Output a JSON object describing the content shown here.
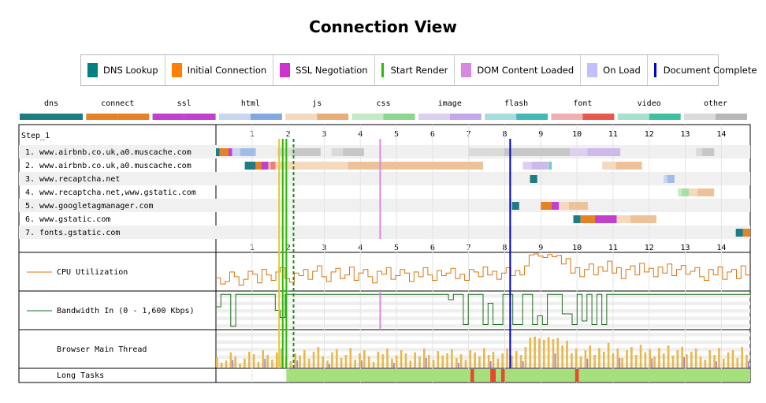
{
  "title": "Connection View",
  "legend": [
    {
      "label": "DNS Lookup",
      "color": "#008080",
      "kind": "box"
    },
    {
      "label": "Initial Connection",
      "color": "#ff7f00",
      "kind": "box"
    },
    {
      "label": "SSL Negotiation",
      "color": "#cc33cc",
      "kind": "box"
    },
    {
      "label": "Start Render",
      "color": "#28bc00",
      "kind": "line"
    },
    {
      "label": "DOM Content Loaded",
      "color": "#d888df",
      "kind": "box"
    },
    {
      "label": "On Load",
      "color": "#c0c0ff",
      "kind": "box"
    },
    {
      "label": "Document Complete",
      "color": "#0000d0",
      "kind": "line"
    }
  ],
  "type_legend": [
    {
      "label": "dns",
      "light": "#1f7c83",
      "dark": "#1f7c83"
    },
    {
      "label": "connect",
      "light": "#e58226",
      "dark": "#e58226"
    },
    {
      "label": "ssl",
      "light": "#c141cd",
      "dark": "#c141cd"
    },
    {
      "label": "html",
      "light": "#c8d6ee",
      "dark": "#82a8e0"
    },
    {
      "label": "js",
      "light": "#f4d9bd",
      "dark": "#e8ae7a"
    },
    {
      "label": "css",
      "light": "#c3eac3",
      "dark": "#8ed68e"
    },
    {
      "label": "image",
      "light": "#dccff0",
      "dark": "#c2a8e8"
    },
    {
      "label": "flash",
      "light": "#a6dcdc",
      "dark": "#45b8b8"
    },
    {
      "label": "font",
      "light": "#f0b0b0",
      "dark": "#e8584f"
    },
    {
      "label": "video",
      "light": "#a8e0d0",
      "dark": "#40c0a0"
    },
    {
      "label": "other",
      "light": "#dadada",
      "dark": "#b8b8b8"
    }
  ],
  "step_label": "Step_1",
  "rows": [
    "1. www.airbnb.co.uk,a0.muscache.com",
    "2. www.airbnb.co.uk,a0.muscache.com",
    "3. www.recaptcha.net",
    "4. www.recaptcha.net,www.gstatic.com",
    "5. www.googletagmanager.com",
    "6. www.gstatic.com",
    "7. fonts.gstatic.com"
  ],
  "ticks": [
    "1",
    "2",
    "3",
    "4",
    "5",
    "6",
    "7",
    "8",
    "9",
    "10",
    "11",
    "12",
    "13",
    "14"
  ],
  "graph_labels": {
    "cpu": "CPU Utilization",
    "bandwidth": "Bandwidth In (0 - 1,600 Kbps)",
    "main_thread": "Browser Main Thread",
    "long_tasks": "Long Tasks"
  },
  "chart_data": {
    "type": "waterfall",
    "x_unit": "seconds",
    "xlim": [
      0,
      14.8
    ],
    "markers": {
      "start_render": [
        1.75,
        1.85,
        1.95
      ],
      "dom_content_loaded": 4.55,
      "document_complete": 8.15,
      "dashed": 2.15
    },
    "connections": [
      [
        [
          "dns",
          0,
          0.1
        ],
        [
          "connect",
          0.1,
          0.35
        ],
        [
          "ssl",
          0.35,
          0.45
        ],
        [
          "html",
          0.45,
          1.1
        ],
        [
          "other",
          1.7,
          2.9
        ],
        [
          "other",
          3.2,
          4.1
        ],
        [
          "other",
          7,
          9.8
        ],
        [
          "image",
          9.8,
          11.2
        ],
        [
          "other",
          13.3,
          13.8
        ]
      ],
      [
        [
          "dns",
          0.8,
          1.1
        ],
        [
          "connect",
          1.1,
          1.25
        ],
        [
          "ssl",
          1.25,
          1.45
        ],
        [
          "font",
          1.45,
          1.65
        ],
        [
          "js",
          1.65,
          7.4
        ],
        [
          "image",
          8.5,
          9.2
        ],
        [
          "flash",
          9.2,
          9.3
        ],
        [
          "js",
          10.7,
          11.8
        ]
      ],
      [
        [
          "dns",
          8.7,
          8.9
        ],
        [
          "html",
          12.4,
          12.7
        ]
      ],
      [
        [
          "css",
          12.8,
          13.1
        ],
        [
          "js",
          13.1,
          13.8
        ]
      ],
      [
        [
          "dns",
          8.2,
          8.4
        ],
        [
          "connect",
          9.0,
          9.3
        ],
        [
          "ssl",
          9.3,
          9.5
        ],
        [
          "js",
          9.5,
          10.3
        ]
      ],
      [
        [
          "dns",
          9.9,
          10.1
        ],
        [
          "connect",
          10.1,
          10.5
        ],
        [
          "ssl",
          10.5,
          11.1
        ],
        [
          "js",
          11.1,
          12.2
        ]
      ],
      [
        [
          "dns",
          14.4,
          14.6
        ],
        [
          "connect",
          14.6,
          14.8
        ]
      ]
    ],
    "cpu": [
      32,
      15,
      22,
      48,
      35,
      12,
      28,
      50,
      42,
      18,
      55,
      40,
      25,
      48,
      60,
      30,
      20,
      45,
      38,
      55,
      28,
      50,
      65,
      35,
      22,
      48,
      58,
      30,
      40,
      62,
      25,
      45,
      55,
      35,
      18,
      50,
      42,
      60,
      28,
      38,
      55,
      45,
      22,
      48,
      35,
      60,
      40,
      25,
      52,
      38,
      45,
      58,
      30,
      42,
      25,
      55,
      48,
      35,
      62,
      40,
      50,
      28,
      45,
      60,
      38,
      52,
      40,
      65,
      95,
      98,
      92,
      88,
      96,
      90,
      94,
      70,
      85,
      45,
      60,
      35,
      55,
      70,
      40,
      62,
      50,
      78,
      45,
      60,
      30,
      55,
      65,
      40,
      72,
      48,
      58,
      35,
      62,
      45,
      70,
      38,
      55,
      66,
      42,
      50,
      60,
      35,
      25,
      55,
      40,
      62,
      28,
      48,
      55,
      30,
      65,
      40
    ],
    "bandwidth": [
      60,
      95,
      95,
      5,
      95,
      95,
      95,
      95,
      95,
      95,
      95,
      95,
      50,
      30,
      95,
      95,
      95,
      95,
      95,
      95,
      95,
      95,
      95,
      95,
      95,
      95,
      95,
      95,
      95,
      95,
      95,
      95,
      95,
      95,
      95,
      95,
      95,
      95,
      95,
      95,
      95,
      95,
      95,
      95,
      95,
      95,
      95,
      80,
      95,
      95,
      10,
      95,
      95,
      95,
      10,
      70,
      10,
      10,
      95,
      95,
      10,
      10,
      95,
      95,
      10,
      35,
      10,
      95,
      95,
      95,
      40,
      40,
      10,
      95,
      20,
      95,
      10,
      95,
      10,
      95,
      95,
      95,
      95,
      95,
      95,
      95,
      95,
      95,
      95,
      95,
      95,
      95,
      95,
      95,
      95,
      95,
      95,
      95,
      95,
      95,
      95,
      95,
      95,
      95,
      95,
      95,
      95,
      95
    ],
    "long_tasks": [
      [
        7.05,
        7.15
      ],
      [
        7.6,
        7.75
      ],
      [
        7.9,
        8.0
      ],
      [
        9.95,
        10.05
      ]
    ]
  }
}
